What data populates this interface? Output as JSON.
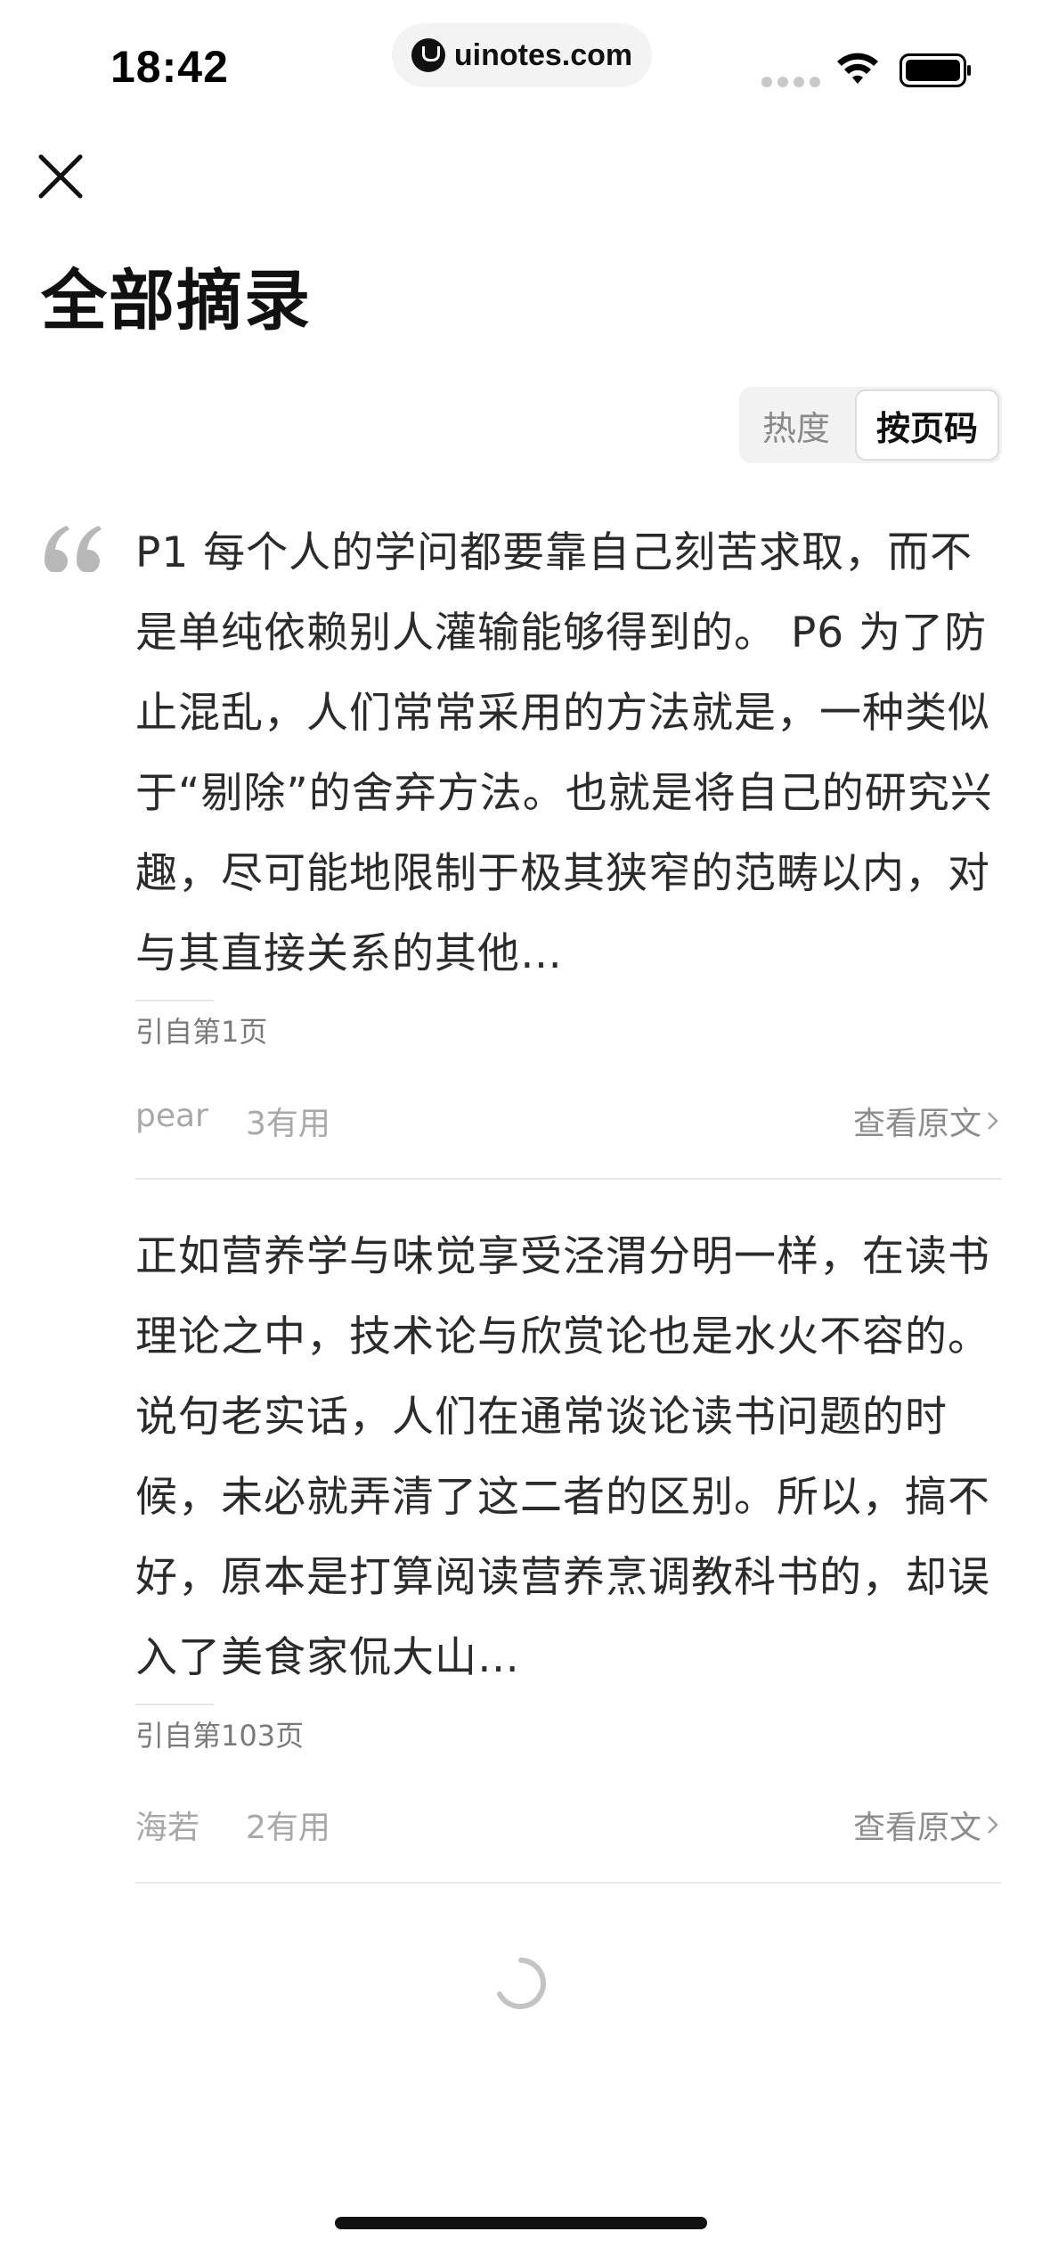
{
  "status_bar": {
    "time": "18:42",
    "url": "uinotes.com",
    "icons": [
      "signal-icon",
      "wifi-icon",
      "battery-icon"
    ]
  },
  "header": {
    "close_icon": "close-icon",
    "title": "全部摘录"
  },
  "sort": {
    "options": [
      "热度",
      "按页码"
    ],
    "selected": "按页码"
  },
  "excerpts": [
    {
      "text": "P1 每个人的学问都要靠自己刻苦求取，而不是单纯依赖别人灌输能够得到的。 P6 为了防止混乱，人们常常采用的方法就是，一种类似于“剔除”的舍弃方法。也就是将自己的研究兴趣，尽可能地限制于极其狭窄的范畴以内，对与其直接关系的其他…",
      "source": "引自第1页",
      "author": "pear",
      "likes": "3有用",
      "view_label": "查看原文"
    },
    {
      "text": "正如营养学与味觉享受泾渭分明一样，在读书理论之中，技术论与欣赏论也是水火不容的。说句老实话，人们在通常谈论读书问题的时候，未必就弄清了这二者的区别。所以，搞不好，原本是打算阅读营养烹调教科书的，却误入了美食家侃大山…",
      "source": "引自第103页",
      "author": "海若",
      "likes": "2有用",
      "view_label": "查看原文"
    }
  ],
  "colors": {
    "text_primary": "#111111",
    "text_body": "#2b2b2b",
    "text_muted": "#a8a8a8",
    "divider": "#e8e8e8",
    "control_bg": "#f2f2f2"
  }
}
